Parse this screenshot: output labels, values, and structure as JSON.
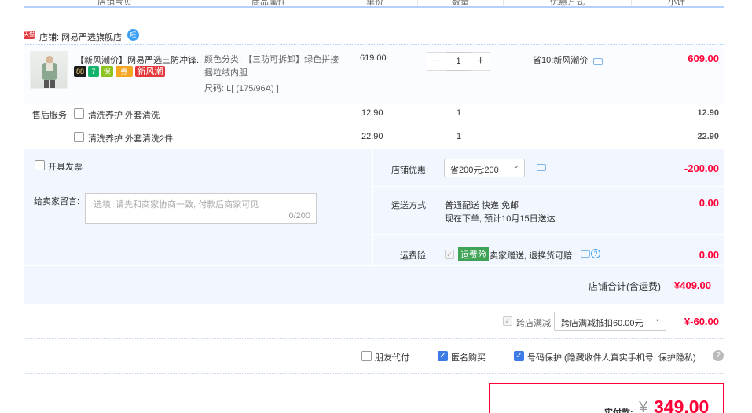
{
  "header": {
    "col_shop_item": "店铺宝贝",
    "col_attr": "商品属性",
    "col_unit_price": "单价",
    "col_qty": "数量",
    "col_promo": "优惠方式",
    "col_subtotal": "小计"
  },
  "shop": {
    "icon_text": "天猫",
    "label": "店铺:",
    "name": "网易严选旗舰店",
    "chat_icon_text": "旺"
  },
  "item": {
    "title": "【新风潮价】网易严选三防冲锋...",
    "attr_color": "颜色分类: 【三防可拆卸】绿色拼接 摇粒绒内胆",
    "attr_size": "尺码: L[ (175/96A) ]",
    "unit_price": "619.00",
    "qty": "1",
    "minus": "−",
    "plus": "+",
    "promo": "省10:新风潮价",
    "subtotal": "609.00",
    "badges": [
      "88",
      "7",
      "保",
      "券",
      "新风潮"
    ]
  },
  "services": {
    "label": "售后服务",
    "rows": [
      {
        "name": "清洗养护 外套清洗",
        "price": "12.90",
        "qty": "1",
        "subtotal": "12.90"
      },
      {
        "name": "清洗养护 外套清洗2件",
        "price": "22.90",
        "qty": "1",
        "subtotal": "22.90"
      }
    ]
  },
  "invoice": {
    "label": "开具发票"
  },
  "message": {
    "label": "给卖家留言:",
    "placeholder": "选填, 请先和商家协商一致, 付款后商家可见",
    "counter": "0/200"
  },
  "shop_discount": {
    "label": "店铺优惠:",
    "selected": "省200元:200",
    "amount": "-200.00"
  },
  "shipping": {
    "label": "运送方式:",
    "method": "普通配送 快递 免邮",
    "eta": "现在下单, 预计10月15日送达",
    "amount": "0.00"
  },
  "insurance": {
    "label": "运费险:",
    "tag": "运费险",
    "desc": "卖家赠送, 退换货可赔",
    "amount": "0.00"
  },
  "shop_total": {
    "label": "店铺合计(含运费)",
    "amount": "¥409.00"
  },
  "cross_store": {
    "label": "跨店满减",
    "selected": "跨店满减抵扣60.00元",
    "amount": "¥-60.00"
  },
  "options": {
    "friend_pay": "朋友代付",
    "anonymous": "匿名购买",
    "privacy": "号码保护 (隐藏收件人真实手机号, 保护隐私)",
    "help": "?"
  },
  "payment": {
    "label": "实付款:",
    "currency": "¥",
    "amount": "349.00"
  },
  "colors": {
    "accent_red": "#ff0036",
    "accent_blue": "#3d7be6",
    "panel_bg": "#f2f7ff"
  }
}
